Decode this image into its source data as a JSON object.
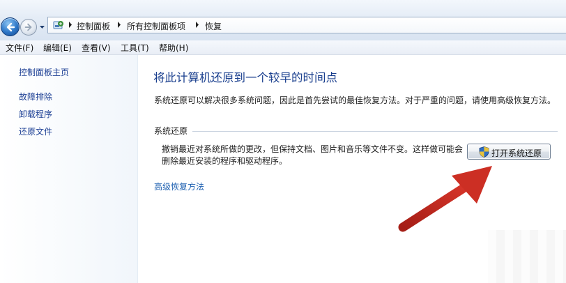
{
  "breadcrumb": [
    "控制面板",
    "所有控制面板项",
    "恢复"
  ],
  "menu": [
    "文件(F)",
    "编辑(E)",
    "查看(V)",
    "工具(T)",
    "帮助(H)"
  ],
  "sidebar": {
    "home": "控制面板主页",
    "items": [
      "故障排除",
      "卸载程序",
      "还原文件"
    ]
  },
  "main": {
    "title": "将此计算机还原到一个较早的时间点",
    "intro": "系统还原可以解决很多系统问题，因此是首先尝试的最佳恢复方法。对于严重的问题，请使用高级恢复方法。",
    "section_title": "系统还原",
    "description": "撤销最近对系统所做的更改，但保持文档、图片和音乐等文件不变。这样做可能会删除最近安装的程序和驱动程序。",
    "open_restore_button": "打开系统还原",
    "advanced_link": "高级恢复方法"
  },
  "colors": {
    "title_blue": "#1a3f8e",
    "link_blue": "#1c5fb0",
    "annotation_arrow": "#c0281e"
  },
  "icons": [
    "back-arrow-icon",
    "forward-arrow-icon",
    "control-panel-icon",
    "shield-icon"
  ]
}
